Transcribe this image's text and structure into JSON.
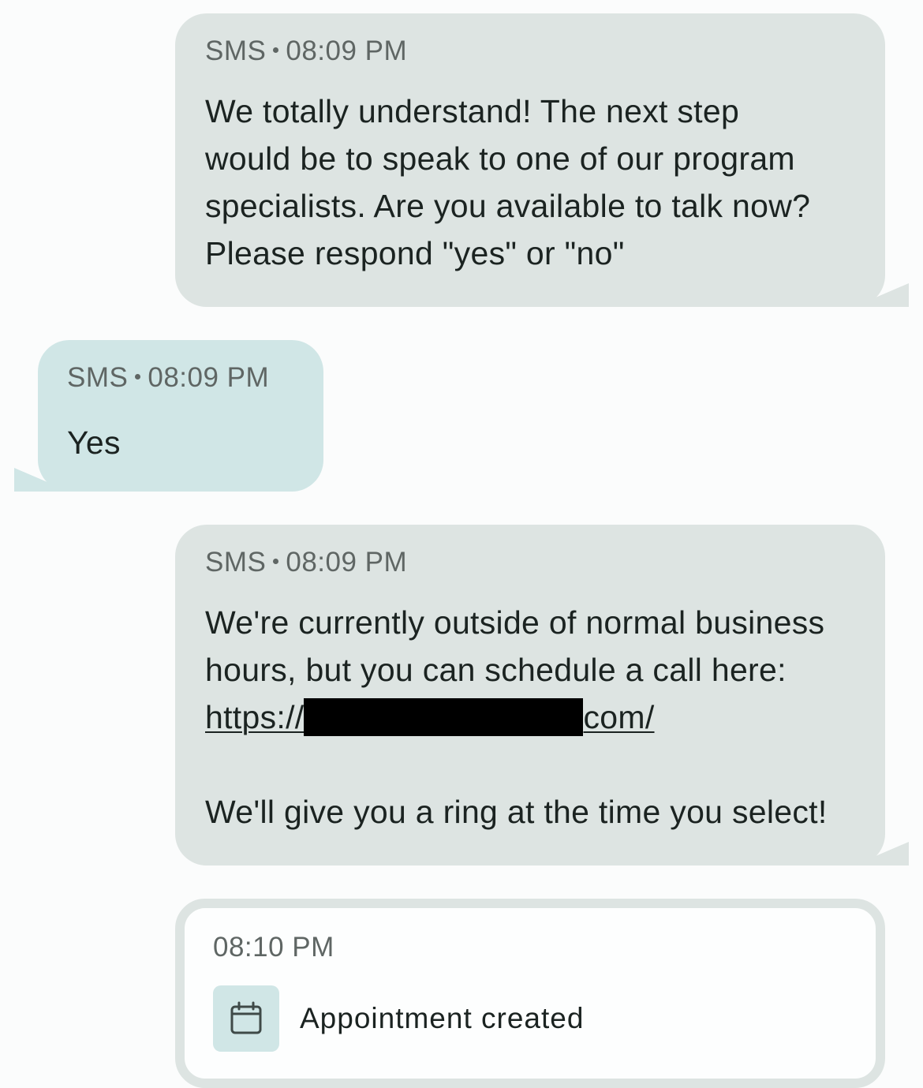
{
  "messages": [
    {
      "channel": "SMS",
      "time": "08:09 PM",
      "lines": [
        "We totally understand! The next step",
        "would be to speak to one of our program",
        "specialists. Are you available to talk now?",
        "Please respond \"yes\" or \"no\""
      ]
    },
    {
      "channel": "SMS",
      "time": "08:09 PM",
      "lines": [
        "Yes"
      ]
    },
    {
      "channel": "SMS",
      "time": "08:09 PM",
      "lines": [
        "We're currently outside of normal business",
        "hours, but you can schedule a call here:"
      ],
      "link_prefix": "https://",
      "link_suffix": "com/",
      "closing": "We'll give you a ring at the time you select!"
    }
  ],
  "event": {
    "time": "08:10 PM",
    "label": "Appointment created",
    "icon": "calendar-icon"
  },
  "colors": {
    "outgoing_bubble": "#dde4e2",
    "incoming_bubble": "#d0e6e6",
    "text": "#1b2321",
    "meta_text": "#5f6664"
  }
}
